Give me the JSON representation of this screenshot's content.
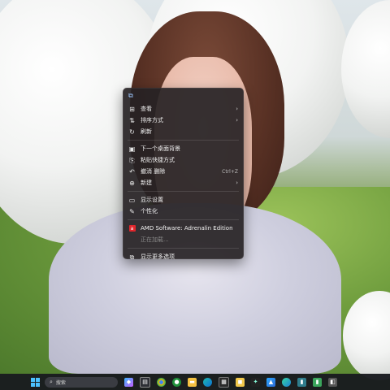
{
  "context_menu": {
    "top_icon": "copy-icon",
    "items": [
      {
        "label": "查看",
        "icon": "grid-view-icon",
        "arrow": "›"
      },
      {
        "label": "排序方式",
        "icon": "sort-icon",
        "arrow": "›"
      },
      {
        "label": "刷新",
        "icon": "refresh-icon"
      },
      {
        "label": "下一个桌面背景",
        "icon": "next-background-icon"
      },
      {
        "label": "粘贴快捷方式",
        "icon": "paste-shortcut-icon"
      },
      {
        "label": "撤消 删除",
        "icon": "undo-icon",
        "shortcut": "Ctrl+Z"
      },
      {
        "label": "新建",
        "icon": "new-icon",
        "arrow": "›"
      },
      {
        "label": "显示设置",
        "icon": "display-settings-icon"
      },
      {
        "label": "个性化",
        "icon": "personalize-icon"
      },
      {
        "label": "AMD Software: Adrenalin Edition",
        "icon": "amd-icon"
      },
      {
        "label": "正在加载...",
        "icon": ""
      },
      {
        "label": "显示更多选项",
        "icon": "more-options-icon"
      }
    ]
  },
  "taskbar": {
    "search_placeholder": "搜索",
    "icons": [
      "windows-start-icon",
      "search-icon",
      "avatar-icon",
      "copilot-icon",
      "task-view-icon",
      "chrome-icon",
      "file-explorer-icon",
      "edge-icon",
      "store-icon",
      "app-icon",
      "app-icon",
      "photos-icon",
      "edge-icon",
      "app-icon",
      "app-icon",
      "app-icon"
    ]
  },
  "colors": {
    "menu_bg": "#262224",
    "taskbar_bg": "#181a1e",
    "accent": "#4cc2ff",
    "amd_red": "#e0262c"
  }
}
